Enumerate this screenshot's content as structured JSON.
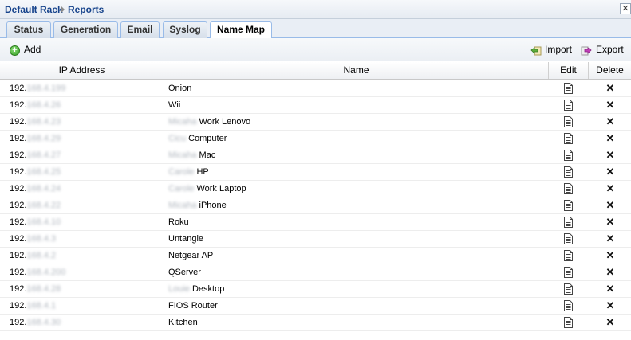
{
  "breadcrumb": {
    "root": "Default Rack",
    "current": "Reports"
  },
  "window": {
    "close_glyph": "✕"
  },
  "tabs": [
    {
      "label": "Status",
      "active": false
    },
    {
      "label": "Generation",
      "active": false
    },
    {
      "label": "Email",
      "active": false
    },
    {
      "label": "Syslog",
      "active": false
    },
    {
      "label": "Name Map",
      "active": true
    }
  ],
  "toolbar": {
    "add_label": "Add",
    "import_label": "Import",
    "export_label": "Export"
  },
  "columns": {
    "ip": "IP Address",
    "name": "Name",
    "edit": "Edit",
    "delete": "Delete"
  },
  "rows": [
    {
      "ip_prefix": "192.",
      "ip_masked": "168.4.199",
      "name_masked": "",
      "name": "Onion"
    },
    {
      "ip_prefix": "192.",
      "ip_masked": "168.4.26",
      "name_masked": "",
      "name": "Wii"
    },
    {
      "ip_prefix": "192.",
      "ip_masked": "168.4.23",
      "name_masked": "Micaha",
      "name": "Work Lenovo"
    },
    {
      "ip_prefix": "192.",
      "ip_masked": "168.4.29",
      "name_masked": "Cicu",
      "name": "Computer"
    },
    {
      "ip_prefix": "192.",
      "ip_masked": "168.4.27",
      "name_masked": "Micaha",
      "name": "Mac"
    },
    {
      "ip_prefix": "192.",
      "ip_masked": "168.4.25",
      "name_masked": "Carole",
      "name": "HP"
    },
    {
      "ip_prefix": "192.",
      "ip_masked": "168.4.24",
      "name_masked": "Carole",
      "name": "Work Laptop"
    },
    {
      "ip_prefix": "192.",
      "ip_masked": "168.4.22",
      "name_masked": "Micaha",
      "name": "iPhone"
    },
    {
      "ip_prefix": "192.",
      "ip_masked": "168.4.10",
      "name_masked": "",
      "name": "Roku"
    },
    {
      "ip_prefix": "192.",
      "ip_masked": "168.4.3",
      "name_masked": "",
      "name": "Untangle"
    },
    {
      "ip_prefix": "192.",
      "ip_masked": "168.4.2",
      "name_masked": "",
      "name": "Netgear AP"
    },
    {
      "ip_prefix": "192.",
      "ip_masked": "168.4.200",
      "name_masked": "",
      "name": "QServer"
    },
    {
      "ip_prefix": "192.",
      "ip_masked": "168.4.28",
      "name_masked": "Louie",
      "name": "Desktop"
    },
    {
      "ip_prefix": "192.",
      "ip_masked": "168.4.1",
      "name_masked": "",
      "name": "FIOS Router"
    },
    {
      "ip_prefix": "192.",
      "ip_masked": "168.4.30",
      "name_masked": "",
      "name": "Kitchen"
    }
  ],
  "icons": {
    "add": "add-circle-icon",
    "import": "import-icon",
    "export": "export-icon",
    "edit": "document-edit-icon",
    "delete": "x-delete-icon"
  },
  "colors": {
    "breadcrumb": "#15428b",
    "tab_border": "#99bbe8",
    "add_green": "#2f9a1f"
  }
}
